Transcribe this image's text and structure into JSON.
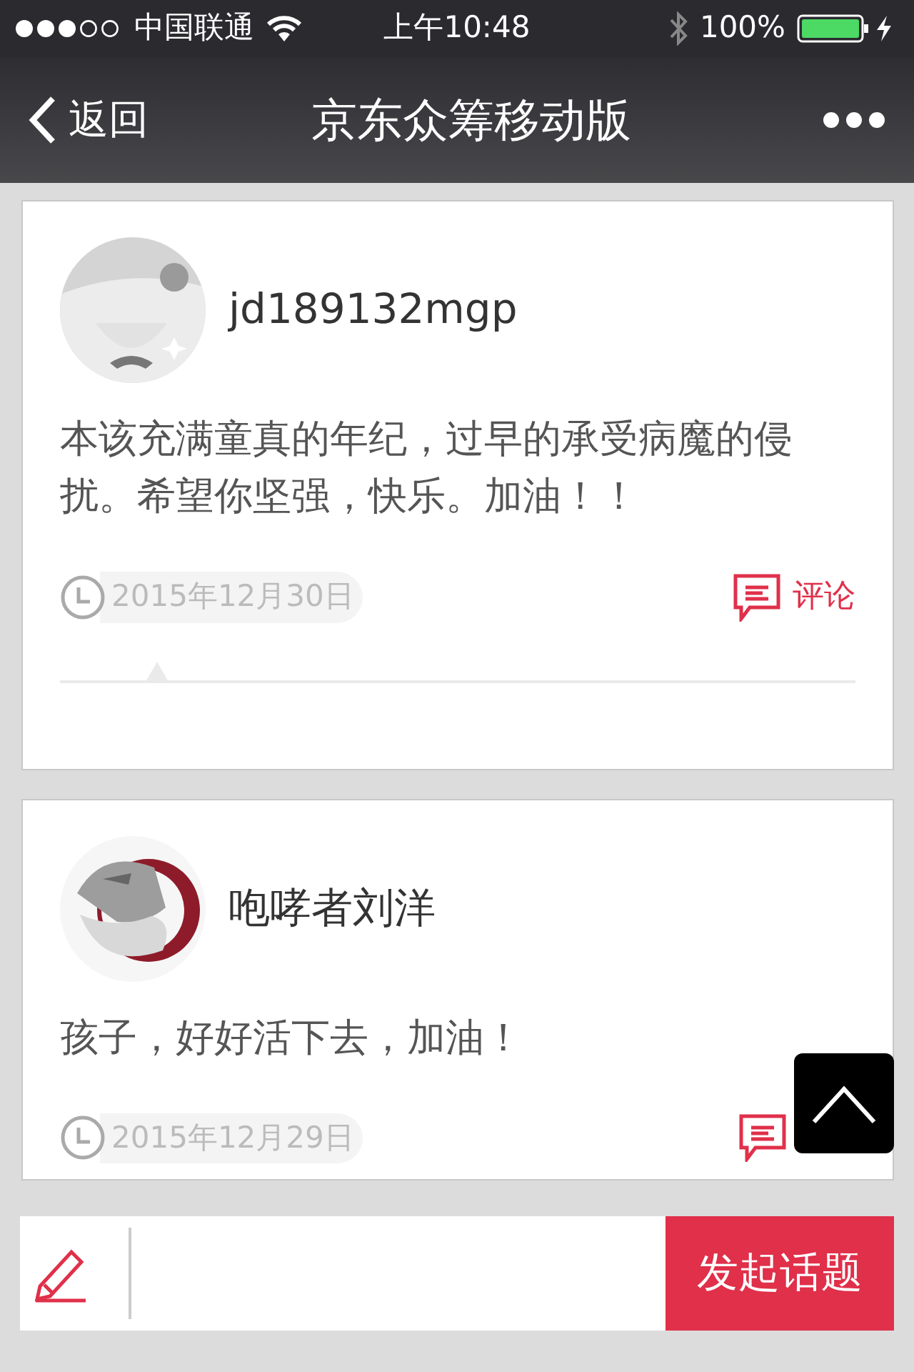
{
  "status_bar": {
    "carrier": "中国联通",
    "time": "上午10:48",
    "battery": "100%"
  },
  "nav": {
    "back": "返回",
    "title": "京东众筹移动版"
  },
  "posts": [
    {
      "user": "jd189132mgp",
      "text": "本该充满童真的年纪，过早的承受病魔的侵扰。希望你坚强，快乐。加油！！",
      "date": "2015年12月30日",
      "comment": "评论"
    },
    {
      "user": "咆哮者刘洋",
      "text": "孩子，好好活下去，加油！",
      "date": "2015年12月29日"
    }
  ],
  "composer": {
    "button": "发起话题"
  }
}
